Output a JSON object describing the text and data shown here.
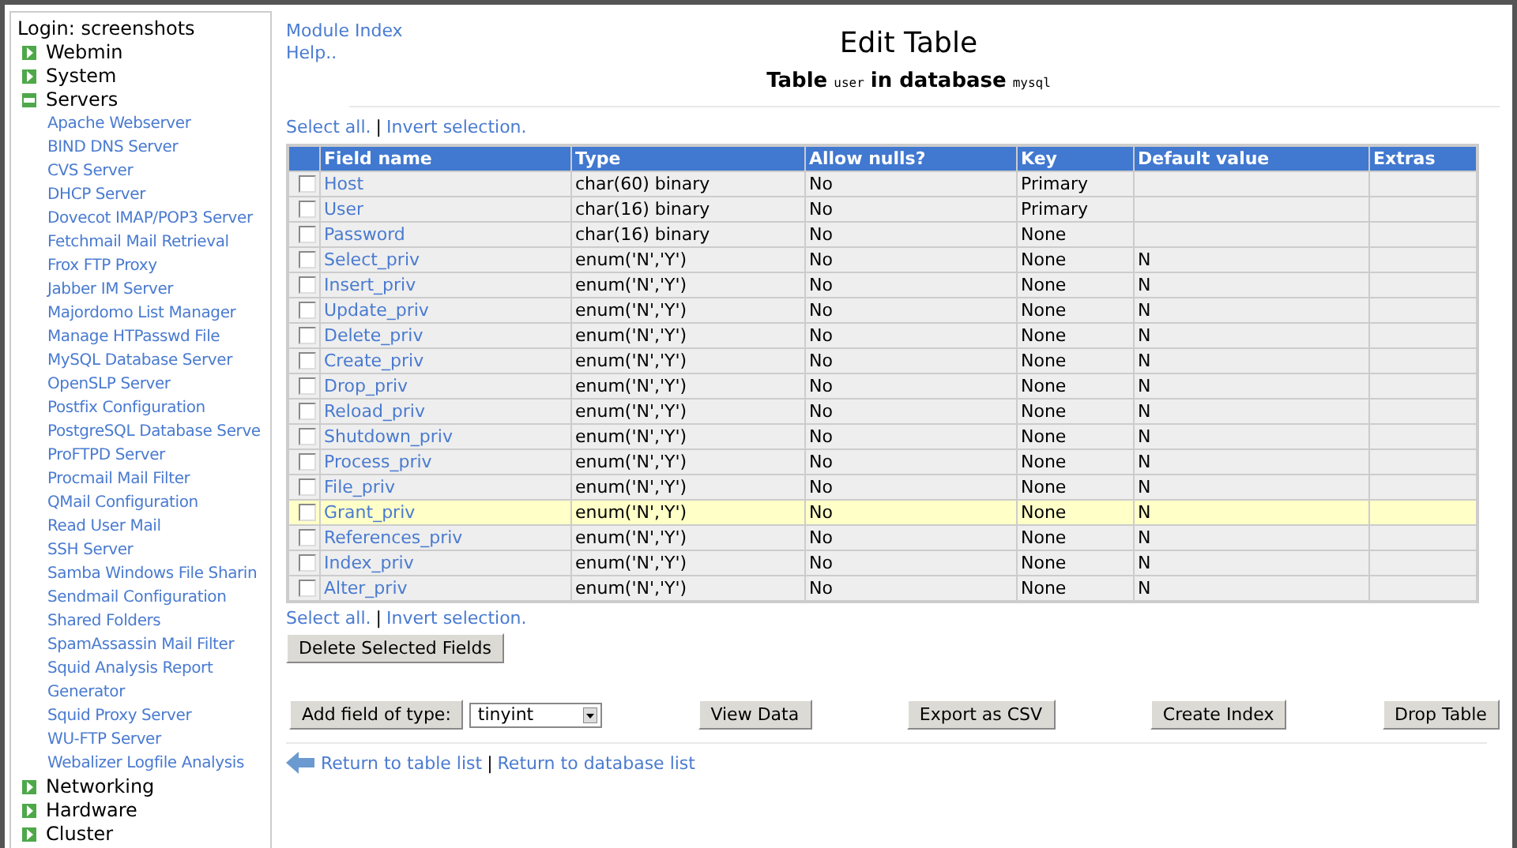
{
  "sidebar": {
    "login": "Login: screenshots",
    "categories": [
      {
        "label": "Webmin",
        "expanded": false
      },
      {
        "label": "System",
        "expanded": false
      },
      {
        "label": "Servers",
        "expanded": true,
        "children": [
          "Apache Webserver",
          "BIND DNS Server",
          "CVS Server",
          "DHCP Server",
          "Dovecot IMAP/POP3 Server",
          "Fetchmail Mail Retrieval",
          "Frox FTP Proxy",
          "Jabber IM Server",
          "Majordomo List Manager",
          "Manage HTPasswd File",
          "MySQL Database Server",
          "OpenSLP Server",
          "Postfix Configuration",
          "PostgreSQL Database Serve",
          "ProFTPD Server",
          "Procmail Mail Filter",
          "QMail Configuration",
          "Read User Mail",
          "SSH Server",
          "Samba Windows File Sharin",
          "Sendmail Configuration",
          "Shared Folders",
          "SpamAssassin Mail Filter",
          "Squid Analysis Report Generator",
          "Squid Proxy Server",
          "WU-FTP Server",
          "Webalizer Logfile Analysis"
        ]
      },
      {
        "label": "Networking",
        "expanded": false
      },
      {
        "label": "Hardware",
        "expanded": false
      },
      {
        "label": "Cluster",
        "expanded": false
      }
    ]
  },
  "top_links": [
    "Module Index",
    "Help.."
  ],
  "title": "Edit Table",
  "subtitle": {
    "table_label": "Table",
    "table_name": "user",
    "db_label": "in database",
    "db_name": "mysql"
  },
  "selection_links_top": [
    "Select all.",
    "|",
    "Invert selection."
  ],
  "table": {
    "columns": [
      "Field name",
      "Type",
      "Allow nulls?",
      "Key",
      "Default value",
      "Extras"
    ],
    "rows": [
      {
        "checked": false,
        "highlighted": false,
        "field": "Host",
        "type": "char(60) binary",
        "nulls": "No",
        "key": "Primary"
      },
      {
        "checked": false,
        "highlighted": false,
        "field": "User",
        "type": "char(16) binary",
        "nulls": "No",
        "key": "Primary"
      },
      {
        "checked": false,
        "highlighted": false,
        "field": "Password",
        "type": "char(16) binary",
        "nulls": "No",
        "key": "None"
      },
      {
        "checked": false,
        "highlighted": false,
        "field": "Select_priv",
        "type": "enum('N','Y')",
        "nulls": "No",
        "key": "None",
        "default": "N"
      },
      {
        "checked": false,
        "highlighted": false,
        "field": "Insert_priv",
        "type": "enum('N','Y')",
        "nulls": "No",
        "key": "None",
        "default": "N"
      },
      {
        "checked": false,
        "highlighted": false,
        "field": "Update_priv",
        "type": "enum('N','Y')",
        "nulls": "No",
        "key": "None",
        "default": "N"
      },
      {
        "checked": false,
        "highlighted": false,
        "field": "Delete_priv",
        "type": "enum('N','Y')",
        "nulls": "No",
        "key": "None",
        "default": "N"
      },
      {
        "checked": false,
        "highlighted": false,
        "field": "Create_priv",
        "type": "enum('N','Y')",
        "nulls": "No",
        "key": "None",
        "default": "N"
      },
      {
        "checked": false,
        "highlighted": false,
        "field": "Drop_priv",
        "type": "enum('N','Y')",
        "nulls": "No",
        "key": "None",
        "default": "N"
      },
      {
        "checked": false,
        "highlighted": false,
        "field": "Reload_priv",
        "type": "enum('N','Y')",
        "nulls": "No",
        "key": "None",
        "default": "N"
      },
      {
        "checked": false,
        "highlighted": false,
        "field": "Shutdown_priv",
        "type": "enum('N','Y')",
        "nulls": "No",
        "key": "None",
        "default": "N"
      },
      {
        "checked": false,
        "highlighted": false,
        "field": "Process_priv",
        "type": "enum('N','Y')",
        "nulls": "No",
        "key": "None",
        "default": "N"
      },
      {
        "checked": false,
        "highlighted": false,
        "field": "File_priv",
        "type": "enum('N','Y')",
        "nulls": "No",
        "key": "None",
        "default": "N"
      },
      {
        "checked": false,
        "highlighted": true,
        "field": "Grant_priv",
        "type": "enum('N','Y')",
        "nulls": "No",
        "key": "None",
        "default": "N"
      },
      {
        "checked": false,
        "highlighted": false,
        "field": "References_priv",
        "type": "enum('N','Y')",
        "nulls": "No",
        "key": "None",
        "default": "N"
      },
      {
        "checked": false,
        "highlighted": false,
        "field": "Index_priv",
        "type": "enum('N','Y')",
        "nulls": "No",
        "key": "None",
        "default": "N"
      },
      {
        "checked": false,
        "highlighted": false,
        "field": "Alter_priv",
        "type": "enum('N','Y')",
        "nulls": "No",
        "key": "None",
        "default": "N"
      }
    ]
  },
  "selection_links_bottom": [
    "Select all.",
    "|",
    "Invert selection."
  ],
  "delete_button": "Delete Selected Fields",
  "add_field": {
    "button": "Add field of type:",
    "value": "tinyint"
  },
  "action_buttons": [
    "View Data",
    "Export as CSV",
    "Create Index",
    "Drop Table"
  ],
  "footer_links": [
    "Return to table list",
    "|",
    "Return to database list"
  ]
}
